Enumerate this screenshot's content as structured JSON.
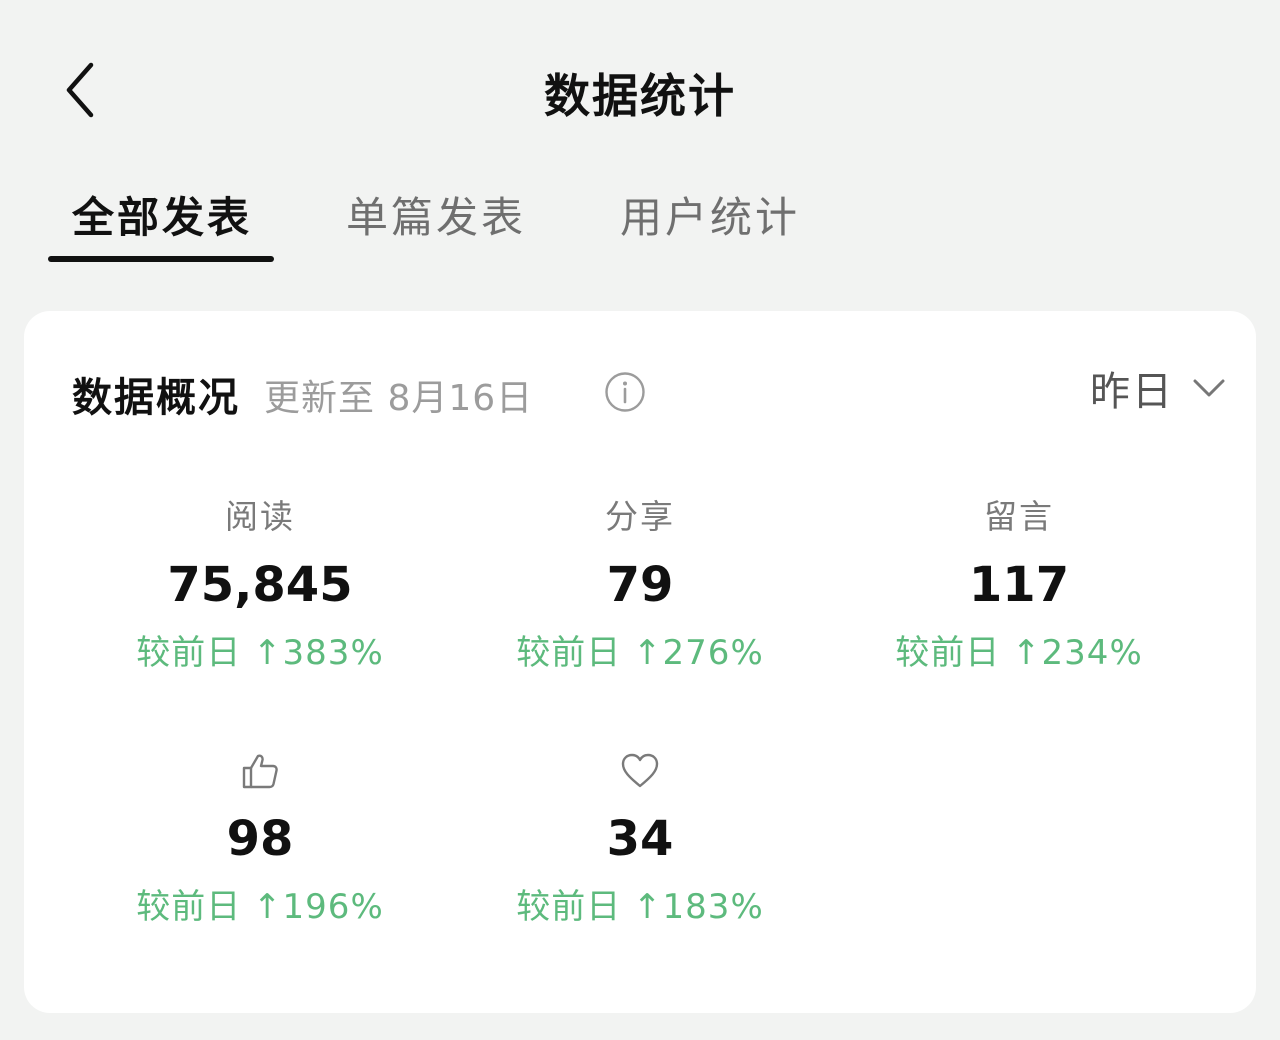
{
  "header": {
    "title": "数据统计"
  },
  "tabs": [
    {
      "label": "全部发表",
      "active": true
    },
    {
      "label": "单篇发表",
      "active": false
    },
    {
      "label": "用户统计",
      "active": false
    }
  ],
  "overview": {
    "title": "数据概况",
    "update_text": "更新至 8月16日",
    "period": "昨日"
  },
  "metrics": [
    {
      "label": "阅读",
      "value": "75,845",
      "change": "较前日 ↑383%"
    },
    {
      "label": "分享",
      "value": "79",
      "change": "较前日 ↑276%"
    },
    {
      "label": "留言",
      "value": "117",
      "change": "较前日 ↑234%"
    },
    {
      "icon": "thumbs-up-icon",
      "value": "98",
      "change": "较前日 ↑196%"
    },
    {
      "icon": "heart-icon",
      "value": "34",
      "change": "较前日 ↑183%"
    }
  ],
  "colors": {
    "accent_green": "#5dba7d",
    "background": "#f2f3f2",
    "card": "#ffffff"
  }
}
